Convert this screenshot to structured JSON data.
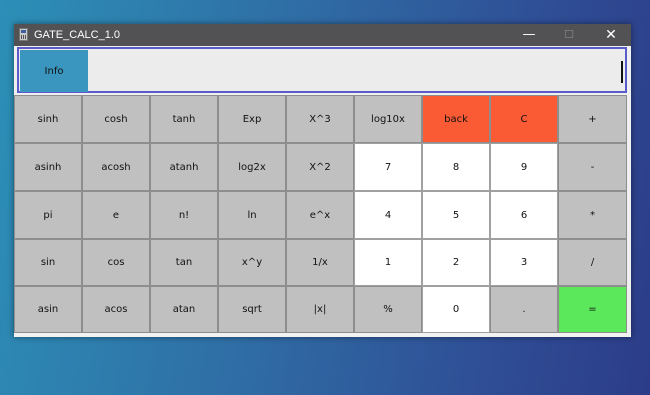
{
  "window": {
    "title": "GATE_CALC_1.0",
    "controls": {
      "minimize": "—",
      "maximize": "☐",
      "close": "✕"
    }
  },
  "display": {
    "info_label": "Info",
    "value": ""
  },
  "keys": [
    [
      "sinh",
      "cosh",
      "tanh",
      "Exp",
      "X^3",
      "log10x",
      "back",
      "C",
      "+"
    ],
    [
      "asinh",
      "acosh",
      "atanh",
      "log2x",
      "X^2",
      "7",
      "8",
      "9",
      "-"
    ],
    [
      "pi",
      "e",
      "n!",
      "ln",
      "e^x",
      "4",
      "5",
      "6",
      "*"
    ],
    [
      "sin",
      "cos",
      "tan",
      "x^y",
      "1/x",
      "1",
      "2",
      "3",
      "/"
    ],
    [
      "asin",
      "acos",
      "atan",
      "sqrt",
      "|x|",
      "%",
      "0",
      ".",
      "="
    ]
  ],
  "colors": {
    "key_default": "#c0c0c0",
    "key_number": "#ffffff",
    "key_back_clear": "#fa5a34",
    "key_equals": "#5be85a",
    "info_button": "#3a96bf",
    "titlebar": "#525254"
  }
}
